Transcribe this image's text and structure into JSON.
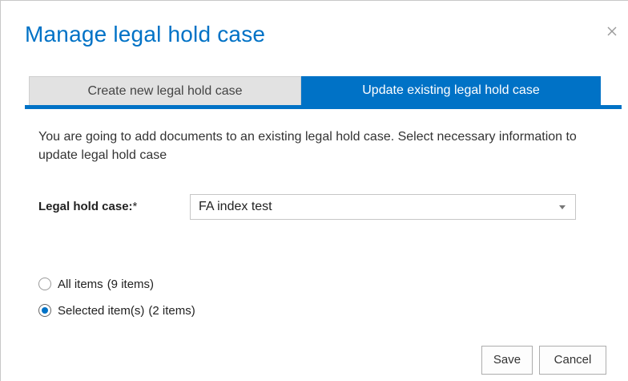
{
  "dialog": {
    "title": "Manage legal hold case",
    "close_icon": "close-icon"
  },
  "tabs": [
    {
      "label": "Create new legal hold case",
      "active": false
    },
    {
      "label": "Update existing legal hold case",
      "active": true
    }
  ],
  "description": "You are going to add documents to an existing legal hold case. Select necessary information to update legal hold case",
  "legal_hold_field": {
    "label": "Legal hold case:",
    "required_marker": "*",
    "selected_value": "FA index test"
  },
  "scope_options": [
    {
      "label": "All items",
      "count": "(9 items)",
      "checked": false
    },
    {
      "label": "Selected item(s)",
      "count": "(2 items)",
      "checked": true
    }
  ],
  "buttons": {
    "save_label": "Save",
    "cancel_label": "Cancel"
  },
  "colors": {
    "accent": "#0072c6",
    "inactive_tab": "#e2e2e2"
  }
}
